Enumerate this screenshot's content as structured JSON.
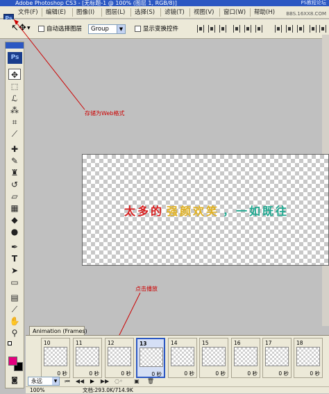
{
  "window": {
    "title": "Adobe Photoshop CS3 - [无标题-1 @ 100% (图层 1, RGB/8)]",
    "watermark_top": "PS教程论坛",
    "watermark_menu": "BBS.16XX8.COM"
  },
  "menu": [
    "文件(F)",
    "编辑(E)",
    "图像(I)",
    "图层(L)",
    "选择(S)",
    "滤镜(T)",
    "视图(V)",
    "窗口(W)",
    "帮助(H)"
  ],
  "options": {
    "auto_select_label": "自动选择图层",
    "group_value": "Group",
    "show_transform_label": "显示变换控件"
  },
  "tools": {
    "logo": "Ps"
  },
  "canvas": {
    "text_parts": [
      {
        "text": "太多的",
        "color": "#d81e1e"
      },
      {
        "text": "强颜欢笑",
        "color": "#e0b020"
      },
      {
        "text": "，一如既往",
        "color": "#1fa890"
      }
    ]
  },
  "annotations": {
    "save_for_web": "存储为Web格式",
    "click_play": "点击播放"
  },
  "animation": {
    "tab_label": "Animation (Frames)",
    "frames": [
      {
        "num": "10",
        "delay": "0 秒",
        "selected": false
      },
      {
        "num": "11",
        "delay": "0 秒",
        "selected": false
      },
      {
        "num": "12",
        "delay": "0 秒",
        "selected": false
      },
      {
        "num": "13",
        "delay": "0 秒",
        "selected": true
      },
      {
        "num": "14",
        "delay": "0 秒",
        "selected": false
      },
      {
        "num": "15",
        "delay": "0 秒",
        "selected": false
      },
      {
        "num": "16",
        "delay": "0 秒",
        "selected": false
      },
      {
        "num": "17",
        "delay": "0 秒",
        "selected": false
      },
      {
        "num": "18",
        "delay": "0 秒",
        "selected": false
      }
    ],
    "loop_value": "永远"
  },
  "status": {
    "zoom": "100%",
    "doc": "文档:293.0K/714.9K"
  }
}
